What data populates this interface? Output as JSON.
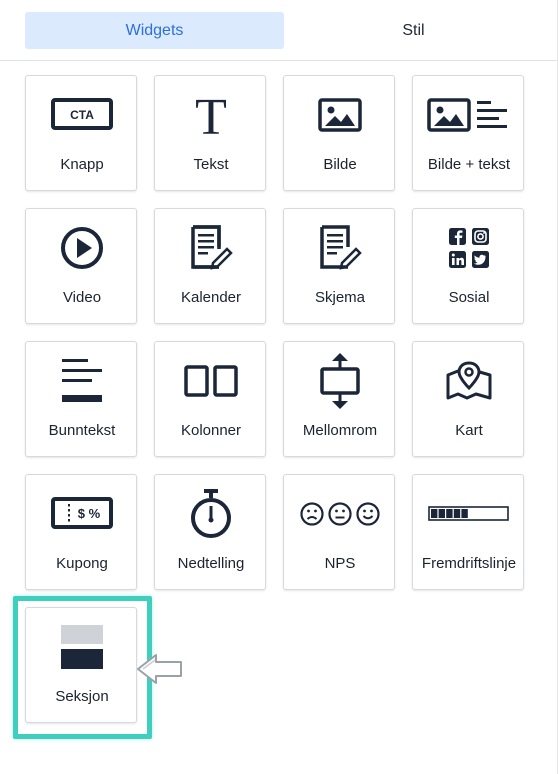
{
  "tabs": {
    "widgets": "Widgets",
    "style": "Stil"
  },
  "widgets": {
    "knapp": {
      "label": "Knapp",
      "icon_text": "CTA"
    },
    "tekst": {
      "label": "Tekst",
      "icon_text": "T"
    },
    "bilde": {
      "label": "Bilde"
    },
    "bilde_tekst": {
      "label": "Bilde + tekst"
    },
    "video": {
      "label": "Video"
    },
    "kalender": {
      "label": "Kalender"
    },
    "skjema": {
      "label": "Skjema"
    },
    "sosial": {
      "label": "Sosial"
    },
    "bunntekst": {
      "label": "Bunntekst"
    },
    "kolonner": {
      "label": "Kolonner"
    },
    "mellomrom": {
      "label": "Mellomrom"
    },
    "kart": {
      "label": "Kart"
    },
    "kupong": {
      "label": "Kupong",
      "icon_text": "$ %"
    },
    "nedtelling": {
      "label": "Nedtelling"
    },
    "nps": {
      "label": "NPS"
    },
    "fremdriftslinje": {
      "label": "Fremdriftslinje",
      "progress": 0.5
    },
    "seksjon": {
      "label": "Seksjon"
    }
  },
  "colors": {
    "accent": "#2d6fe0",
    "active_tab_bg": "#dbeafd",
    "icon": "#1b2638",
    "highlight": "#3ecfbf"
  }
}
